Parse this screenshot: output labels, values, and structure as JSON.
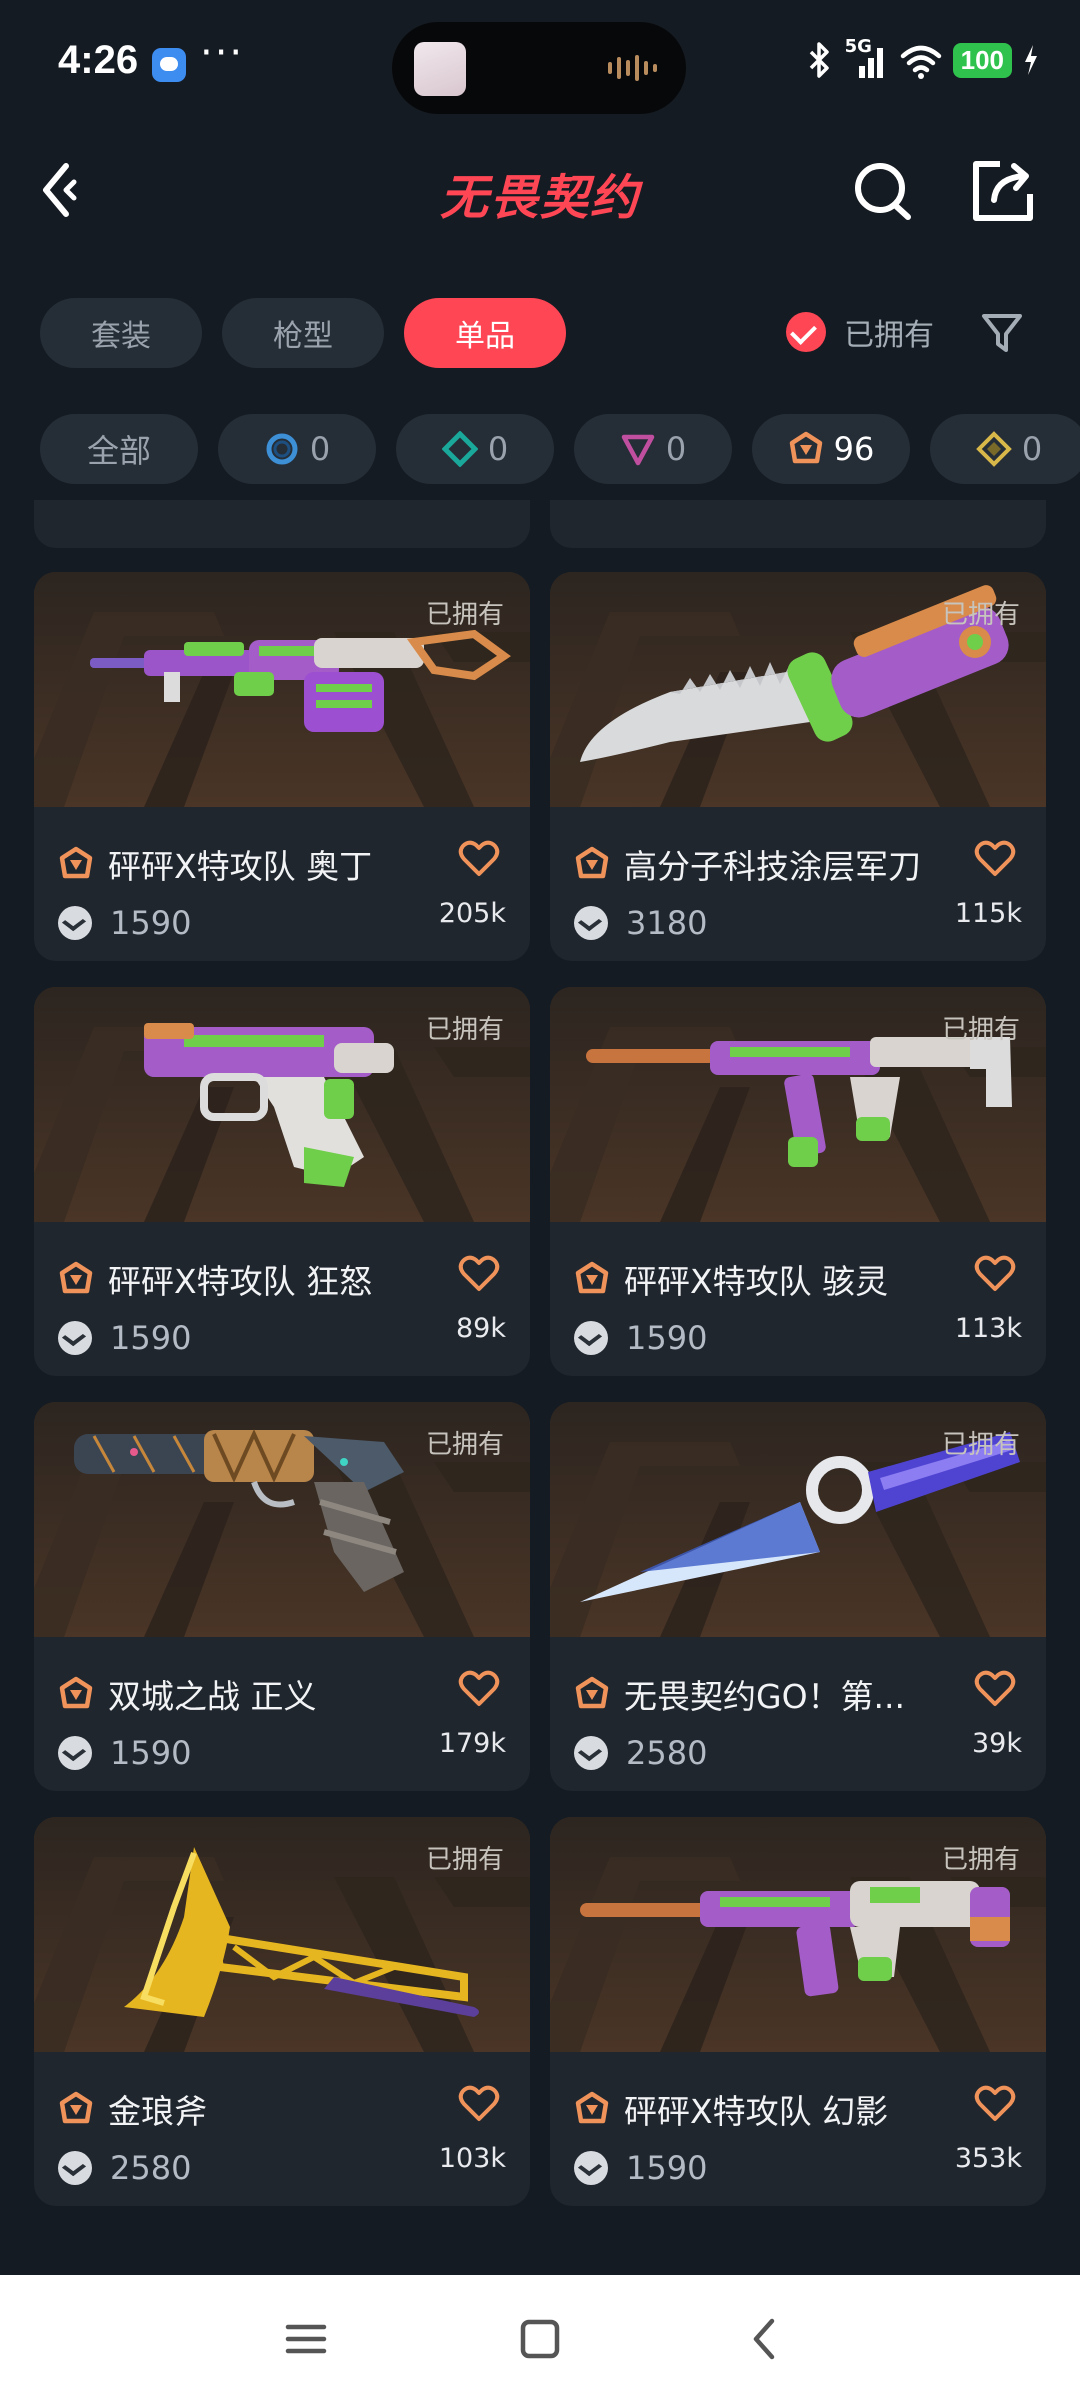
{
  "status_bar": {
    "time": "4:26",
    "more": "···",
    "network": "5G",
    "battery": "100"
  },
  "header": {
    "title": "无畏契约",
    "back_icon": "back-arrow-icon",
    "search_icon": "search-icon",
    "share_icon": "share-icon"
  },
  "tabs": [
    {
      "label": "套装",
      "active": false
    },
    {
      "label": "枪型",
      "active": false
    },
    {
      "label": "单品",
      "active": true
    }
  ],
  "owned_filter": {
    "label": "已拥有",
    "checked": true
  },
  "filter_icon": "funnel-icon",
  "tiers": [
    {
      "label": "全部",
      "count": "",
      "color": ""
    },
    {
      "label": "",
      "count": "0",
      "color": "#3d8fd6",
      "icon": "select-tier-icon"
    },
    {
      "label": "",
      "count": "0",
      "color": "#1aa89a",
      "icon": "deluxe-tier-icon"
    },
    {
      "label": "",
      "count": "0",
      "color": "#c04fa0",
      "icon": "premium-tier-icon"
    },
    {
      "label": "",
      "count": "96",
      "color": "#f0935a",
      "icon": "exclusive-tier-icon"
    },
    {
      "label": "",
      "count": "0",
      "color": "#d9b84a",
      "icon": "ultra-tier-icon"
    }
  ],
  "items": [
    {
      "name": "砰砰X特攻队 奥丁",
      "price": "1590",
      "likes": "205k",
      "owned": "已拥有",
      "weapon": "machine-gun"
    },
    {
      "name": "高分子科技涂层军刀",
      "price": "3180",
      "likes": "115k",
      "owned": "已拥有",
      "weapon": "knife"
    },
    {
      "name": "砰砰X特攻队 狂怒",
      "price": "1590",
      "likes": "89k",
      "owned": "已拥有",
      "weapon": "pistol"
    },
    {
      "name": "砰砰X特攻队 骇灵",
      "price": "1590",
      "likes": "113k",
      "owned": "已拥有",
      "weapon": "smg"
    },
    {
      "name": "双城之战 正义",
      "price": "1590",
      "likes": "179k",
      "owned": "已拥有",
      "weapon": "revolver"
    },
    {
      "name": "无畏契约GO！第...",
      "price": "2580",
      "likes": "39k",
      "owned": "已拥有",
      "weapon": "kunai"
    },
    {
      "name": "金琅斧",
      "price": "2580",
      "likes": "103k",
      "owned": "已拥有",
      "weapon": "axe"
    },
    {
      "name": "砰砰X特攻队 幻影",
      "price": "1590",
      "likes": "353k",
      "owned": "已拥有",
      "weapon": "rifle"
    }
  ],
  "colors": {
    "accent": "#ff4655",
    "background": "#151b22",
    "card": "#1f262e",
    "chip": "#252d36",
    "exclusive_tier": "#f0935a",
    "heart": "#f0935a"
  },
  "nav": {
    "menu_icon": "menu-icon",
    "home_icon": "home-square-icon",
    "back_icon": "nav-back-icon"
  }
}
